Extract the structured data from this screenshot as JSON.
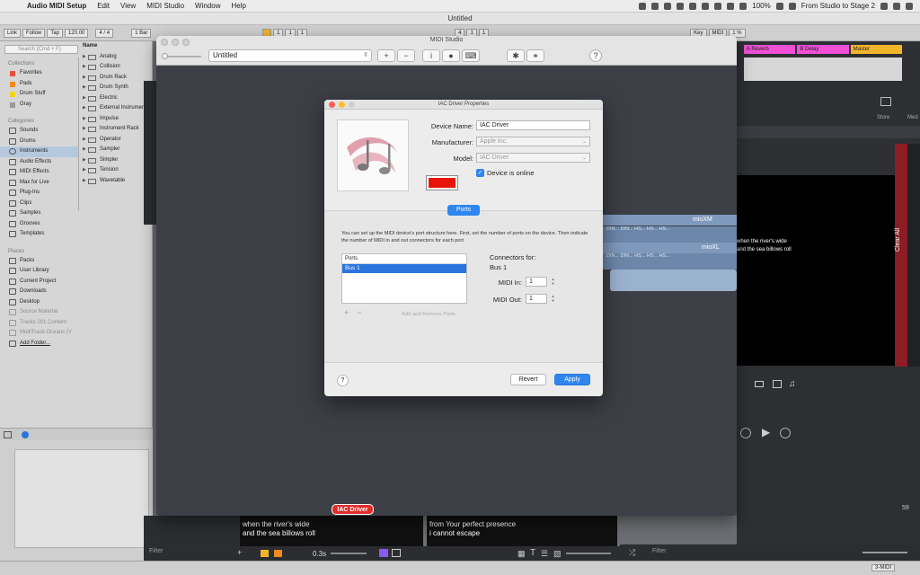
{
  "menubar": {
    "app": "Audio MIDI Setup",
    "items": [
      "Edit",
      "View",
      "MIDI Studio",
      "Window",
      "Help"
    ],
    "battery": "100%",
    "clock": "From Studio to Stage 2"
  },
  "live": {
    "window_title": "Untitled",
    "controls": [
      "Link",
      "Follow",
      "Tap",
      "120.00",
      "4 / 4",
      "1 Bar",
      "1",
      "1",
      "1",
      "4",
      "1",
      "1",
      "Key",
      "MIDI",
      "1 %"
    ],
    "search_placeholder": "Search (Cmd + F)",
    "collections_header": "Collections",
    "collections": [
      {
        "label": "Favorites",
        "color": "#e5503b"
      },
      {
        "label": "Pads",
        "color": "#f28a1e"
      },
      {
        "label": "Drum Stuff",
        "color": "#f5d21c"
      },
      {
        "label": "Gray",
        "color": "#9a9a9a"
      }
    ],
    "categories_header": "Categories",
    "categories": [
      "Sounds",
      "Drums",
      "Instruments",
      "Audio Effects",
      "MIDI Effects",
      "Max for Live",
      "Plug-Ins",
      "Clips",
      "Samples",
      "Grooves",
      "Templates"
    ],
    "places_header": "Places",
    "places": [
      "Packs",
      "User Library",
      "Current Project",
      "Downloads",
      "Desktop",
      "Source Material",
      "Tracks 201 Content",
      "MultiTrack-Oceans (V",
      "Add Folder..."
    ],
    "name_header": "Name",
    "instruments": [
      "Analog",
      "Collision",
      "Drum Rack",
      "Drum Synth",
      "Electric",
      "External Instrument",
      "Impulse",
      "Instrument Rack",
      "Operator",
      "Sampler",
      "Simpler",
      "Tension",
      "Wavetable"
    ],
    "tracks": [
      {
        "label": "A Reverb",
        "color": "#f04fd6"
      },
      {
        "label": "B Delay",
        "color": "#f04fd6"
      },
      {
        "label": "Master",
        "color": "#f2b52a"
      }
    ],
    "right_tabs": [
      "Store",
      "Med"
    ],
    "clear_all": "Clear All",
    "lyric_left": [
      "when the river's wide",
      "and the sea billows roll"
    ],
    "lyric_right": [
      "from Your perfect presence",
      "i cannot escape"
    ],
    "lyric_small": [
      "when the river's wide",
      "and the sea billows roll"
    ],
    "fade_time": "0.3s",
    "filter": "Filter",
    "midi_badge": "3-MIDI",
    "number_59": "59"
  },
  "midi_studio": {
    "title": "MIDI Studio",
    "config": "Untitled",
    "iac_badge": "IAC Driver",
    "mioxm": "mioXM",
    "mioxl": "mioXL",
    "din_row": "DIN... DIN... HS... HS... HS..."
  },
  "dialog": {
    "title": "IAC Driver Properties",
    "device_name_label": "Device Name:",
    "device_name": "IAC Driver",
    "manufacturer_label": "Manufacturer:",
    "manufacturer": "Apple Inc.",
    "model_label": "Model:",
    "model": "IAC Driver",
    "online_label": "Device is online",
    "ports_tab": "Ports",
    "description": "You can set up the MIDI device's port structure here. First, set the number of ports on the device. Then indicate the number of MIDI in and out connectors for each port.",
    "ports_header": "Ports",
    "ports": [
      "Bus 1"
    ],
    "add_remove": "Add and Remove Ports",
    "connectors_for": "Connectors for:",
    "connectors_bus": "Bus 1",
    "midi_in_label": "MIDI In:",
    "midi_in": "1",
    "midi_out_label": "MIDI Out:",
    "midi_out": "1",
    "revert": "Revert",
    "apply": "Apply",
    "swatch_color": "#e8140a"
  }
}
